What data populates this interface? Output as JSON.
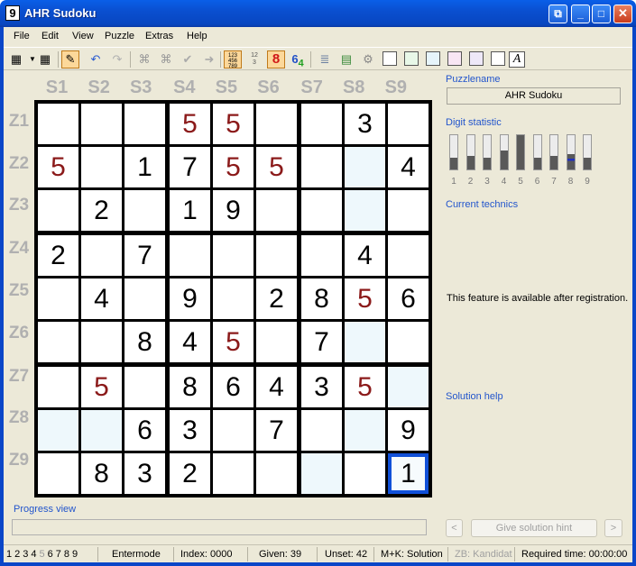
{
  "window": {
    "title": "AHR Sudoku",
    "app_icon_glyph": "9",
    "controls": [
      "restore-icon",
      "minimize-icon",
      "maximize-icon",
      "close-icon"
    ]
  },
  "menu": [
    "File",
    "Edit",
    "View",
    "Puzzle",
    "Extras",
    "Help"
  ],
  "toolbar": {
    "digit_tool_label": "8",
    "digit_small_label": "6",
    "digit_small_label2": "4",
    "text_tool_label": "A",
    "swatch_colors": [
      "#ffffff",
      "#e8f8e8",
      "#e6f4fb",
      "#f8e6f4",
      "#eee8f8",
      "#ffffff"
    ]
  },
  "board": {
    "column_labels": [
      "S1",
      "S2",
      "S3",
      "S4",
      "S5",
      "S6",
      "S7",
      "S8",
      "S9"
    ],
    "row_labels": [
      "Z1",
      "Z2",
      "Z3",
      "Z4",
      "Z5",
      "Z6",
      "Z7",
      "Z8",
      "Z9"
    ],
    "cells": [
      [
        "",
        "",
        "",
        "5r",
        "5r",
        "",
        "",
        "3",
        ""
      ],
      [
        "5r",
        "",
        "1",
        "7",
        "5r",
        "5r",
        "",
        "",
        "4"
      ],
      [
        "",
        "2",
        "",
        "1",
        "9",
        "",
        "",
        "",
        ""
      ],
      [
        "2",
        "",
        "7",
        "",
        "",
        "",
        "",
        "4",
        ""
      ],
      [
        "",
        "4",
        "",
        "9",
        "",
        "2",
        "8",
        "5r",
        "6"
      ],
      [
        "",
        "",
        "8",
        "4",
        "5r",
        "",
        "7",
        "",
        ""
      ],
      [
        "",
        "5r",
        "",
        "8",
        "6",
        "4",
        "3",
        "5r",
        ""
      ],
      [
        "",
        "",
        "6",
        "3",
        "",
        "7",
        "",
        "",
        "9"
      ],
      [
        "",
        "8",
        "3",
        "2",
        "",
        "",
        "",
        "",
        "1"
      ]
    ],
    "selected_cell": {
      "row": 8,
      "col": 8
    },
    "highlight_color": "#eef8fc",
    "given_color": "#000000",
    "entered_color": "#8b1a1a"
  },
  "right_panel": {
    "puzzlename_label": "Puzzlename",
    "puzzlename_value": "AHR Sudoku",
    "digit_statistic_label": "Digit statistic",
    "digit_numbers": [
      "1",
      "2",
      "3",
      "4",
      "5",
      "6",
      "7",
      "8",
      "9"
    ],
    "digit_fill_fractions": [
      0.35,
      0.4,
      0.35,
      0.55,
      1.0,
      0.35,
      0.4,
      0.45,
      0.35
    ],
    "current_technics_label": "Current technics",
    "registration_note": "This feature is available after registration.",
    "solution_help_label": "Solution help"
  },
  "progress": {
    "label": "Progress view",
    "value": 0.0
  },
  "hint": {
    "prev_label": "<",
    "button_label": "Give solution hint",
    "next_label": ">"
  },
  "status": {
    "mode_digits": [
      "1",
      "2",
      "3",
      "4",
      "5",
      "6",
      "7",
      "8",
      "9"
    ],
    "dim_digit": "5",
    "entermode": "Entermode",
    "index": "Index: 0000",
    "given": "Given: 39",
    "unset": "Unset: 42",
    "mk": "M+K: Solution",
    "zb": "ZB: Kandidat",
    "time": "Required time: 00:00:00"
  }
}
